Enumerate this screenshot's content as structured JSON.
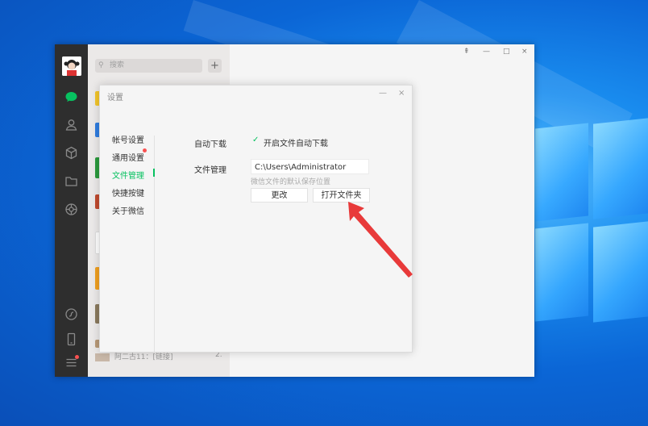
{
  "colors": {
    "accent": "#07c160",
    "arrow": "#e83a3a",
    "sidebar": "#2e2e2e",
    "badge": "#fa5151"
  },
  "sidebar": {
    "items": [
      {
        "icon": "chat-icon",
        "active": true
      },
      {
        "icon": "contacts-icon",
        "active": false
      },
      {
        "icon": "favorites-icon",
        "active": false
      },
      {
        "icon": "folder-icon",
        "active": false
      },
      {
        "icon": "moments-icon",
        "active": false
      },
      {
        "icon": "mini-program-icon",
        "active": false
      },
      {
        "icon": "phone-icon",
        "active": false
      },
      {
        "icon": "menu-icon",
        "active": false,
        "badge": true
      }
    ]
  },
  "chat_list": {
    "search_placeholder": "搜索",
    "add_label": "+",
    "last_item_preview": "阿二古11：[链接]",
    "last_item_time": "2."
  },
  "window_controls": {
    "pin": "⇞",
    "minimize": "—",
    "maximize": "□",
    "close": "×"
  },
  "settings": {
    "title": "设置",
    "minimize": "—",
    "close": "×",
    "nav": [
      {
        "label": "帐号设置",
        "active": false
      },
      {
        "label": "通用设置",
        "active": false,
        "badge": true
      },
      {
        "label": "文件管理",
        "active": true
      },
      {
        "label": "快捷按键",
        "active": false
      },
      {
        "label": "关于微信",
        "active": false
      }
    ],
    "auto_download": {
      "label": "自动下载",
      "checkbox_label": "开启文件自动下载",
      "checked": true
    },
    "file_management": {
      "label": "文件管理",
      "path": "C:\\Users\\Administrator",
      "hint": "微信文件的默认保存位置",
      "change_button": "更改",
      "open_folder_button": "打开文件夹"
    }
  }
}
